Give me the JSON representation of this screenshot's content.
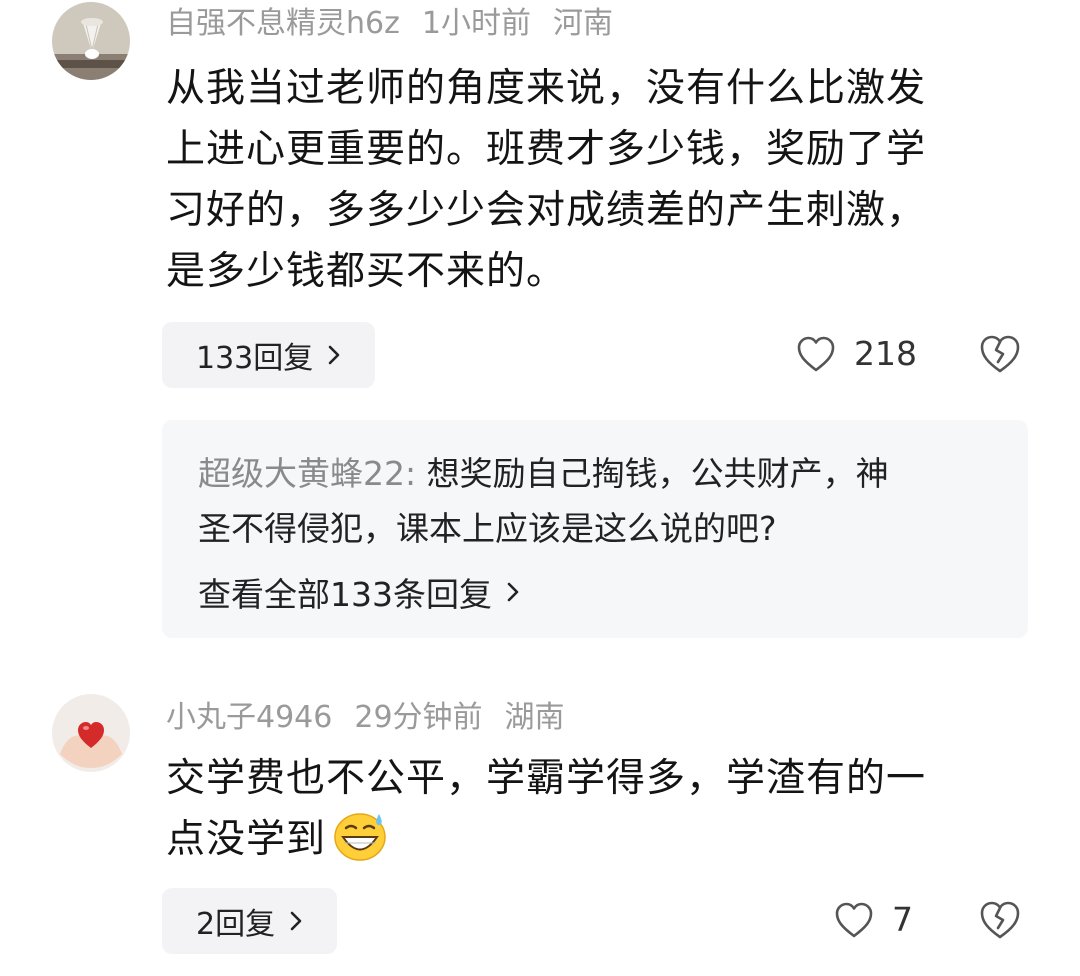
{
  "comments": [
    {
      "author": "自强不息精灵h6z",
      "time": "1小时前",
      "location": "河南",
      "text_lines": [
        "从我当过老师的角度来说，没有什么比激发",
        "上进心更重要的。班费才多少钱，奖励了学",
        "习好的，多多少少会对成绩差的产生刺激，",
        "是多少钱都买不来的。"
      ],
      "reply_label": "133回复",
      "likes": "218",
      "sub_reply": {
        "author": "超级大黄蜂22:",
        "text_line1": " 想奖励自己掏钱，公共财产，神",
        "text_line2": "圣不得侵犯，课本上应该是这么说的吧?",
        "view_all": "查看全部133条回复"
      }
    },
    {
      "author": "小丸子4946",
      "time": "29分钟前",
      "location": "湖南",
      "text_lines": [
        "交学费也不公平，学霸学得多，学渣有的一",
        "点没学到"
      ],
      "emoji": "grinning-sweat-emoji",
      "reply_label": "2回复",
      "likes": "7"
    }
  ],
  "colors": {
    "meta_gray": "#9a9a9a",
    "pill_bg": "#f3f3f5",
    "subbox_bg": "#f6f7f9"
  }
}
